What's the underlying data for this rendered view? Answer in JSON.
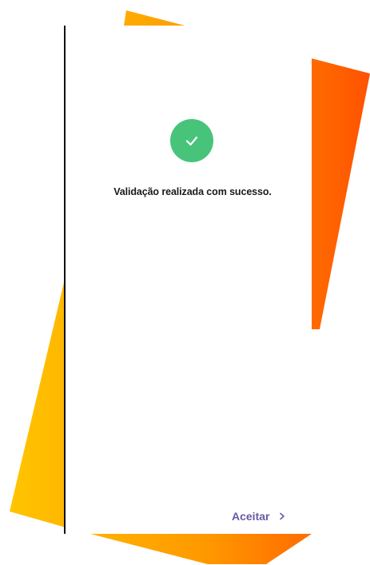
{
  "validation": {
    "message": "Validação realizada com sucesso.",
    "icon": "check-icon",
    "status_color": "#47c47a"
  },
  "footer": {
    "accept_label": "Aceitar",
    "accept_icon": "chevron-right-icon",
    "accent_color": "#6b5aa6"
  },
  "decoration": {
    "gradient_start": "#ffc400",
    "gradient_end": "#ff5a00"
  }
}
